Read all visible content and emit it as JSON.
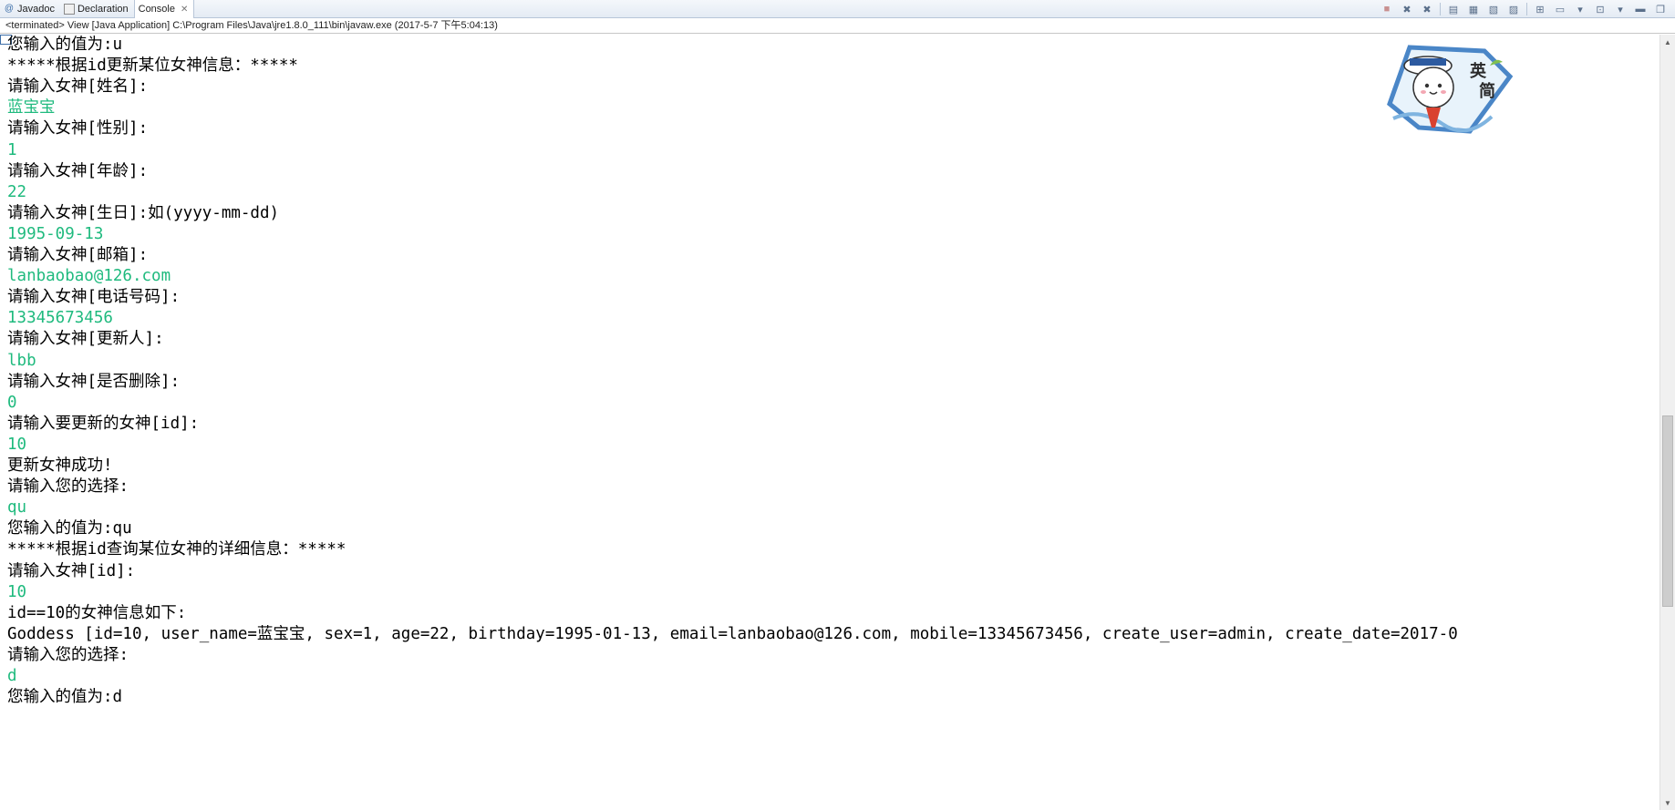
{
  "tabs": [
    {
      "label": "Javadoc",
      "icon": "javadoc-icon"
    },
    {
      "label": "Declaration",
      "icon": "declaration-icon"
    },
    {
      "label": "Console",
      "icon": "console-icon",
      "active": true
    }
  ],
  "status": "<terminated> View [Java Application] C:\\Program Files\\Java\\jre1.8.0_111\\bin\\javaw.exe (2017-5-7 下午5:04:13)",
  "toolbar": {
    "icons": [
      "terminate-icon",
      "remove-launch-icon",
      "remove-all-terminated-icon",
      "scroll-lock-icon",
      "show-when-stdout-icon",
      "show-when-stderr-icon",
      "clear-console-icon",
      "pin-console-icon",
      "display-selected-console-icon",
      "open-console-icon",
      "minimize-icon",
      "maximize-icon"
    ]
  },
  "sticker": {
    "text1": "英",
    "text2": "简"
  },
  "colors": {
    "input_text": "#1fba7e",
    "output_text": "#000000"
  },
  "console": {
    "lines": [
      {
        "type": "out",
        "text": "您输入的值为:u"
      },
      {
        "type": "out",
        "text": "*****根据id更新某位女神信息：*****"
      },
      {
        "type": "out",
        "text": "请输入女神[姓名]:"
      },
      {
        "type": "in",
        "text": "蓝宝宝"
      },
      {
        "type": "out",
        "text": "请输入女神[性别]:"
      },
      {
        "type": "in",
        "text": "1"
      },
      {
        "type": "out",
        "text": "请输入女神[年龄]:"
      },
      {
        "type": "in",
        "text": "22"
      },
      {
        "type": "out",
        "text": "请输入女神[生日]:如(yyyy-mm-dd)"
      },
      {
        "type": "in",
        "text": "1995-09-13"
      },
      {
        "type": "out",
        "text": "请输入女神[邮箱]:"
      },
      {
        "type": "in",
        "text": "lanbaobao@126.com"
      },
      {
        "type": "out",
        "text": "请输入女神[电话号码]:"
      },
      {
        "type": "in",
        "text": "13345673456"
      },
      {
        "type": "out",
        "text": "请输入女神[更新人]:"
      },
      {
        "type": "in",
        "text": "lbb"
      },
      {
        "type": "out",
        "text": "请输入女神[是否删除]:"
      },
      {
        "type": "in",
        "text": "0"
      },
      {
        "type": "out",
        "text": "请输入要更新的女神[id]:"
      },
      {
        "type": "in",
        "text": "10"
      },
      {
        "type": "out",
        "text": "更新女神成功!"
      },
      {
        "type": "out",
        "text": "请输入您的选择:"
      },
      {
        "type": "in",
        "text": "qu"
      },
      {
        "type": "out",
        "text": "您输入的值为:qu"
      },
      {
        "type": "out",
        "text": "*****根据id查询某位女神的详细信息：*****"
      },
      {
        "type": "out",
        "text": "请输入女神[id]:"
      },
      {
        "type": "in",
        "text": "10"
      },
      {
        "type": "out",
        "text": "id==10的女神信息如下:"
      },
      {
        "type": "out",
        "text": "Goddess [id=10, user_name=蓝宝宝, sex=1, age=22, birthday=1995-01-13, email=lanbaobao@126.com, mobile=13345673456, create_user=admin, create_date=2017-0"
      },
      {
        "type": "out",
        "text": "请输入您的选择:"
      },
      {
        "type": "in",
        "text": "d"
      },
      {
        "type": "out",
        "text": "您输入的值为:d"
      }
    ]
  }
}
